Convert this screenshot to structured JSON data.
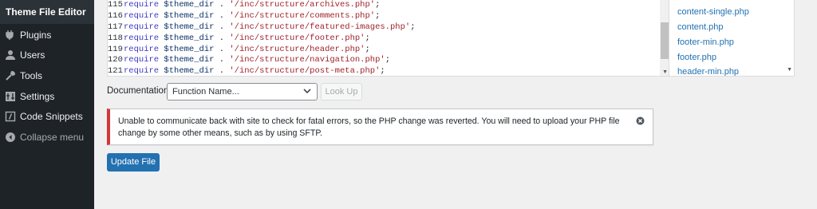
{
  "sidebar": {
    "active_submenu": "Theme File Editor",
    "items": [
      {
        "label": "Plugins",
        "icon": "plug-icon"
      },
      {
        "label": "Users",
        "icon": "user-icon"
      },
      {
        "label": "Tools",
        "icon": "wrench-icon"
      },
      {
        "label": "Settings",
        "icon": "settings-icon"
      },
      {
        "label": "Code Snippets",
        "icon": "code-snippets-icon"
      },
      {
        "label": "Collapse menu",
        "icon": "collapse-icon"
      }
    ]
  },
  "editor": {
    "lines": [
      {
        "num": "115",
        "kw": "require",
        "var": "$theme_dir",
        "op": " . ",
        "str": "'/inc/structure/archives.php'",
        "end": ";"
      },
      {
        "num": "116",
        "kw": "require",
        "var": "$theme_dir",
        "op": " . ",
        "str": "'/inc/structure/comments.php'",
        "end": ";"
      },
      {
        "num": "117",
        "kw": "require",
        "var": "$theme_dir",
        "op": " . ",
        "str": "'/inc/structure/featured-images.php'",
        "end": ";"
      },
      {
        "num": "118",
        "kw": "require",
        "var": "$theme_dir",
        "op": " . ",
        "str": "'/inc/structure/footer.php'",
        "end": ";"
      },
      {
        "num": "119",
        "kw": "require",
        "var": "$theme_dir",
        "op": " . ",
        "str": "'/inc/structure/header.php'",
        "end": ";"
      },
      {
        "num": "120",
        "kw": "require",
        "var": "$theme_dir",
        "op": " . ",
        "str": "'/inc/structure/navigation.php'",
        "end": ";"
      },
      {
        "num": "121",
        "kw": "require",
        "var": "$theme_dir",
        "op": " . ",
        "str": "'/inc/structure/post-meta.php'",
        "end": ";"
      }
    ]
  },
  "files": [
    "content-single.php",
    "content.php",
    "footer-min.php",
    "footer.php",
    "header-min.php"
  ],
  "documentation": {
    "label": "Documentation:",
    "select_value": "Function Name...",
    "lookup_label": "Look Up"
  },
  "notice": {
    "text": "Unable to communicate back with site to check for fatal errors, so the PHP change was reverted. You will need to upload your PHP file change by some other means, such as by using SFTP."
  },
  "update_button": "Update File",
  "colors": {
    "sidebar_bg": "#1d2327",
    "accent": "#2271b1",
    "error": "#d63638",
    "link": "#2271b1"
  }
}
